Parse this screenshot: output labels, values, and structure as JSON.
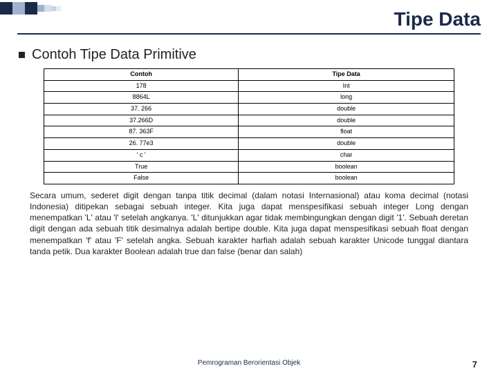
{
  "title": "Tipe Data",
  "section_heading": "Contoh Tipe Data Primitive",
  "table": {
    "headers": [
      "Contoh",
      "Tipe Data"
    ],
    "rows": [
      [
        "178",
        "Int"
      ],
      [
        "8864L",
        "long"
      ],
      [
        "37. 266",
        "double"
      ],
      [
        "37.266D",
        "double"
      ],
      [
        "87. 363F",
        "float"
      ],
      [
        "26. 77e3",
        "double"
      ],
      [
        "' c '",
        "char"
      ],
      [
        "True",
        "boolean"
      ],
      [
        "False",
        "boolean"
      ]
    ]
  },
  "body_text": "Secara umum, sederet digit dengan tanpa titik decimal (dalam notasi Internasional) atau koma decimal (notasi Indonesia) ditipekan sebagai sebuah integer. Kita juga dapat menspesifikasi sebuah integer Long dengan menempatkan 'L' atau 'l' setelah angkanya. 'L' ditunjukkan agar tidak membingungkan dengan digit '1'. Sebuah deretan digit dengan ada sebuah titik desimalnya adalah bertipe double. Kita juga dapat menspesifikasi sebuah float dengan menempatkan 'f' atau 'F' setelah angka. Sebuah karakter harfiah adalah sebuah karakter Unicode tunggal diantara tanda petik. Dua karakter Boolean adalah true dan false (benar dan salah)",
  "footer": {
    "title": "Pemrograman Berorientasi Objek",
    "page": "7"
  },
  "deco_colors": [
    "#1a2a4a",
    "#9fb3d0",
    "#1a2a4a",
    "#9fb3d0",
    "#d7e0ea",
    "#c9d4e2",
    "#e4ebf2"
  ]
}
